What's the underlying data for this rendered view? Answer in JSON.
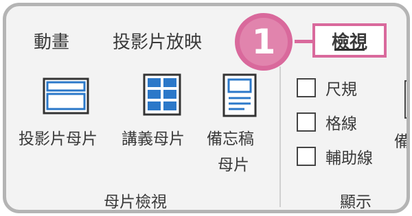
{
  "tabs": {
    "animation": "動畫",
    "slideshow": "投影片放映",
    "view": "檢視"
  },
  "callout": {
    "number": "1"
  },
  "groups": {
    "master_views": {
      "label": "母片檢視",
      "buttons": [
        {
          "label": "投影片母片",
          "icon": "slide-master-icon"
        },
        {
          "label": "講義母片",
          "icon": "handout-master-icon"
        },
        {
          "label_line1": "備忘稿",
          "label_line2": "母片",
          "icon": "notes-master-icon"
        }
      ]
    },
    "show": {
      "label": "顯示",
      "checkboxes": [
        {
          "label": "尺規",
          "checked": false
        },
        {
          "label": "格線",
          "checked": false
        },
        {
          "label": "輔助線",
          "checked": false
        }
      ]
    },
    "cut_off": {
      "label": "備"
    }
  },
  "colors": {
    "callout": "#d9699c",
    "icon_blue": "#2b78c9",
    "frame": "#b4b4b4",
    "ribbon_bg": "#f3f3f3"
  }
}
